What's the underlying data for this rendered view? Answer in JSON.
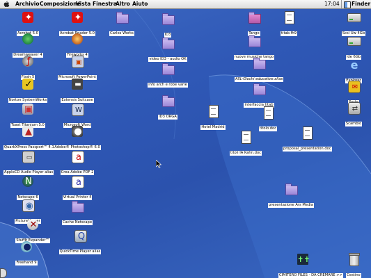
{
  "menubar": {
    "apple_icon": "apple-icon",
    "items": [
      "Archivio",
      "Composizione",
      "Vista",
      "Finestra",
      "Altro",
      "Aiuto"
    ],
    "clock": "17:04",
    "active_app": "Finder"
  },
  "colors": {
    "desktop": "#2f58b6",
    "label_bg": "#ffffff",
    "folder": "#a996e0"
  },
  "icons": [
    {
      "label": "Acrobat 5.0",
      "type": "app",
      "icon": "acrobat-icon"
    },
    {
      "label": "Acrobat Reader 5.0",
      "type": "app",
      "icon": "acrobat-reader-icon"
    },
    {
      "label": "Carlos Works",
      "type": "folder",
      "icon": "folder-icon"
    },
    {
      "label": "ID3",
      "type": "folder",
      "icon": "folder-icon"
    },
    {
      "label": "Tango",
      "type": "folder",
      "icon": "folder-icon"
    },
    {
      "label": "titab.fh9",
      "type": "doc",
      "icon": "freehand-doc-icon"
    },
    {
      "label": "Scsi Uw 4Gb",
      "type": "disk",
      "icon": "hard-disk-icon"
    },
    {
      "label": "Dreamweaver 4",
      "type": "app",
      "icon": "dreamweaver-icon"
    },
    {
      "label": "Fireworks 4",
      "type": "app",
      "icon": "fireworks-icon"
    },
    {
      "label": "video ID3 - audio OK",
      "type": "folder",
      "icon": "folder-icon"
    },
    {
      "label": "nuove musiche tango",
      "type": "folder",
      "icon": "folder-icon"
    },
    {
      "label": "Ide 6Gb",
      "type": "disk",
      "icon": "hard-disk-icon"
    },
    {
      "label": "Flash 5",
      "type": "app",
      "icon": "flash-icon"
    },
    {
      "label": "Microsoft PowerPoint",
      "type": "app",
      "icon": "powerpoint-icon"
    },
    {
      "label": "info arch e robe varie",
      "type": "folder",
      "icon": "folder-icon"
    },
    {
      "label": "ASL-Giochi educative.alias",
      "type": "folder",
      "icon": "folder-alias-icon"
    },
    {
      "label": "Explorer",
      "type": "app",
      "icon": "explorer-icon"
    },
    {
      "label": "Norton SystemWorks",
      "type": "app",
      "icon": "norton-icon"
    },
    {
      "label": "Extensis Suitcase",
      "type": "app",
      "icon": "suitcase-icon"
    },
    {
      "label": "interfaccia titab",
      "type": "folder",
      "icon": "folder-icon"
    },
    {
      "label": "Poste",
      "type": "app",
      "icon": "mail-icon"
    },
    {
      "label": "Toast Titanium 5.0",
      "type": "app",
      "icon": "toast-icon"
    },
    {
      "label": "Microsoft Word",
      "type": "app",
      "icon": "word-icon"
    },
    {
      "label": "ID3 ORGA",
      "type": "folder",
      "icon": "folder-icon"
    },
    {
      "label": "Hotel Madrid",
      "type": "doc",
      "icon": "document-icon"
    },
    {
      "label": "titolo.doc",
      "type": "doc",
      "icon": "word-doc-icon"
    },
    {
      "label": "Scambio",
      "type": "app",
      "icon": "exchange-icon"
    },
    {
      "label": "QuarkXPress Passport™ 4.1",
      "type": "app",
      "icon": "quark-icon"
    },
    {
      "label": "Adobe® Photoshop® 6.0",
      "type": "app",
      "icon": "photoshop-icon"
    },
    {
      "label": "titoli IA Kahn.doc",
      "type": "doc",
      "icon": "word-doc-icon"
    },
    {
      "label": "proposal_presentation.doc",
      "type": "doc",
      "icon": "word-doc-icon"
    },
    {
      "label": "AppleCD Audio Player alias",
      "type": "app",
      "icon": "cd-player-icon"
    },
    {
      "label": "Crea Adobe PDF 2",
      "type": "app",
      "icon": "pdf-maker-icon"
    },
    {
      "label": "Netscape 6",
      "type": "app",
      "icon": "netscape-icon"
    },
    {
      "label": "Virtual Printer 4",
      "type": "app",
      "icon": "printer-icon"
    },
    {
      "label": "presentazione Ars Media",
      "type": "folder",
      "icon": "folder-icon"
    },
    {
      "label": "PictureViewer",
      "type": "app",
      "icon": "pictureviewer-icon"
    },
    {
      "label": "Cache Netscape",
      "type": "folder",
      "icon": "folder-icon"
    },
    {
      "label": "StuffIt Expander™",
      "type": "app",
      "icon": "stuffit-icon"
    },
    {
      "label": "QuickTime Player alias",
      "type": "app",
      "icon": "quicktime-icon"
    },
    {
      "label": "Freehand 9",
      "type": "app",
      "icon": "freehand-icon"
    },
    {
      "label": "CIMITERO FILES - DA CREMARE >>",
      "type": "app",
      "icon": "cemetery-icon"
    },
    {
      "label": "Cestino",
      "type": "trash",
      "icon": "trash-icon"
    }
  ]
}
